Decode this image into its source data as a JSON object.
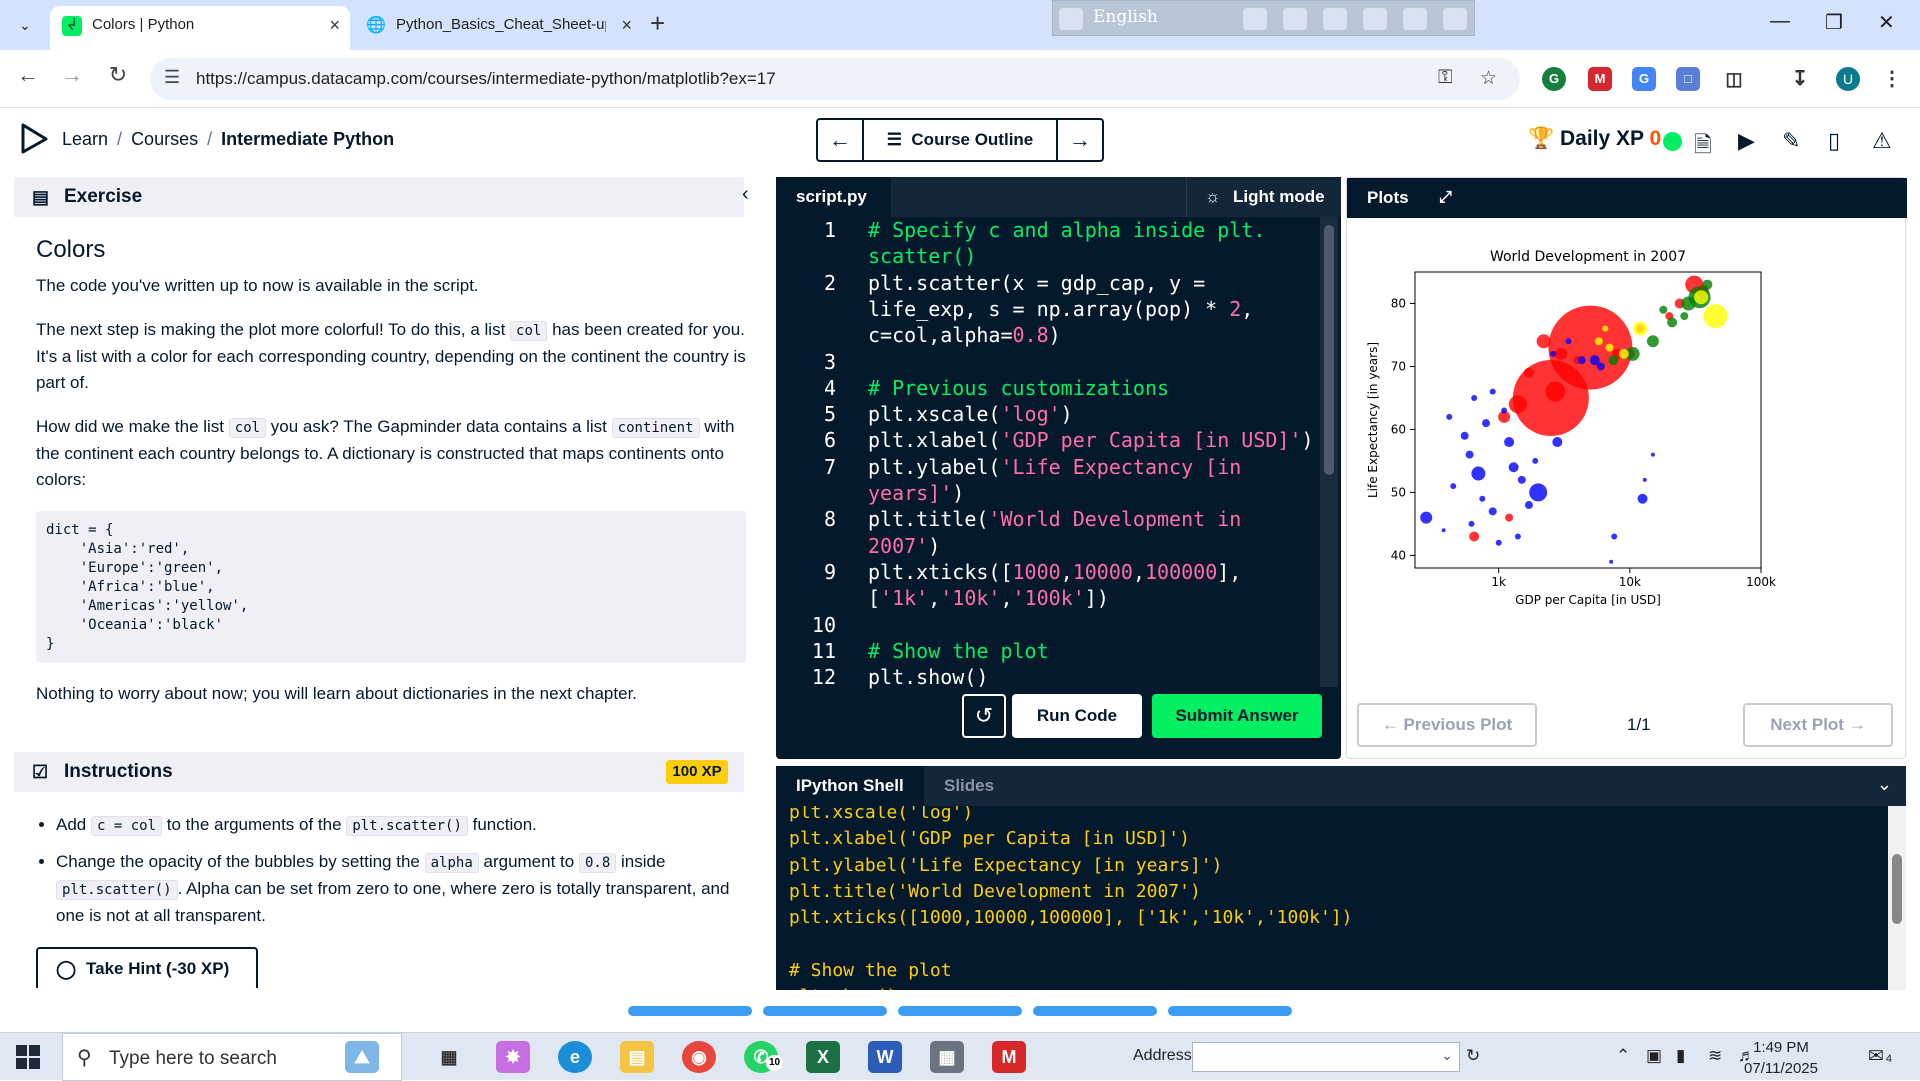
{
  "browser": {
    "tabs": [
      {
        "title": "Colors | Python",
        "active": true,
        "favicon": "datacamp-icon"
      },
      {
        "title": "Python_Basics_Cheat_Sheet-upd",
        "active": false,
        "favicon": "globe-icon"
      }
    ],
    "url": "https://campus.datacamp.com/courses/intermediate-python/matplotlib?ex=17",
    "extension_bar_text": "English",
    "profile_initial": "U"
  },
  "header": {
    "breadcrumbs": [
      "Learn",
      "Courses",
      "Intermediate Python"
    ],
    "course_outline_label": "Course Outline",
    "daily_xp_label": "Daily XP",
    "daily_xp_value": "0"
  },
  "exercise": {
    "section_label": "Exercise",
    "title": "Colors",
    "p1": "The code you've written up to now is available in the script.",
    "p2_a": "The next step is making the plot more colorful! To do this, a list",
    "p2_code": "col",
    "p2_b": "has been created for you. It's a list with a color for each corresponding country, depending on the continent the country is part of.",
    "p3_a": "How did we make the list",
    "p3_code1": "col",
    "p3_b": "you ask? The Gapminder data contains a list",
    "p3_code2": "continent",
    "p3_c": "with the continent each country belongs to. A dictionary is constructed that maps continents onto colors:",
    "code_block": "dict = {\n    'Asia':'red',\n    'Europe':'green',\n    'Africa':'blue',\n    'Americas':'yellow',\n    'Oceania':'black'\n}",
    "p4": "Nothing to worry about now; you will learn about dictionaries in the next chapter."
  },
  "instructions": {
    "section_label": "Instructions",
    "xp_badge": "100 XP",
    "i1_a": "Add",
    "i1_code1": "c = col",
    "i1_b": "to the arguments of the",
    "i1_code2": "plt.scatter()",
    "i1_c": "function.",
    "i2_a": "Change the opacity of the bubbles by setting the",
    "i2_code1": "alpha",
    "i2_b": "argument to",
    "i2_code2": "0.8",
    "i2_c": "inside",
    "i2_code3": "plt.scatter()",
    "i2_d": ". Alpha can be set from zero to one, where zero is totally transparent, and one is not at all transparent.",
    "hint_label": "Take Hint (-30 XP)"
  },
  "editor": {
    "file_tab": "script.py",
    "light_mode_label": "Light mode",
    "line_numbers": [
      "1",
      "2",
      "3",
      "4",
      "5",
      "6",
      "7",
      "8",
      "9",
      "10",
      "11",
      "12"
    ],
    "run_label": "Run Code",
    "submit_label": "Submit Answer"
  },
  "plots": {
    "tab_label": "Plots",
    "previous_label": "Previous Plot",
    "next_label": "Next Plot",
    "counter": "1/1"
  },
  "chart_data": {
    "type": "scatter",
    "title": "World Development in 2007",
    "xlabel": "GDP per Capita [in USD]",
    "ylabel": "Life Expectancy [in years]",
    "xscale": "log",
    "xlim": [
      230,
      100000
    ],
    "ylim": [
      38,
      85
    ],
    "xticks": [
      1000,
      10000,
      100000
    ],
    "xticklabels": [
      "1k",
      "10k",
      "100k"
    ],
    "yticks": [
      40,
      50,
      60,
      70,
      80
    ],
    "yticklabels": [
      "40",
      "50",
      "60",
      "70",
      "80"
    ],
    "colors": {
      "red": "#ff0000",
      "green": "#008000",
      "blue": "#0000ff",
      "yellow": "#ffff00",
      "black": "#000000"
    },
    "points": [
      {
        "x": 5000,
        "y": 73,
        "s": 42,
        "c": "red"
      },
      {
        "x": 2500,
        "y": 65,
        "s": 38,
        "c": "red"
      },
      {
        "x": 2700,
        "y": 66,
        "s": 10,
        "c": "red"
      },
      {
        "x": 1400,
        "y": 64,
        "s": 9,
        "c": "red"
      },
      {
        "x": 1100,
        "y": 62,
        "s": 6,
        "c": "red"
      },
      {
        "x": 1700,
        "y": 69,
        "s": 5,
        "c": "red"
      },
      {
        "x": 2200,
        "y": 74,
        "s": 7,
        "c": "red"
      },
      {
        "x": 3000,
        "y": 72,
        "s": 6,
        "c": "red"
      },
      {
        "x": 10000,
        "y": 72,
        "s": 5,
        "c": "red"
      },
      {
        "x": 24000,
        "y": 80,
        "s": 5,
        "c": "red"
      },
      {
        "x": 31000,
        "y": 83,
        "s": 9,
        "c": "red"
      },
      {
        "x": 36000,
        "y": 82,
        "s": 6,
        "c": "red"
      },
      {
        "x": 12000,
        "y": 76,
        "s": 4,
        "c": "red"
      },
      {
        "x": 8000,
        "y": 72,
        "s": 5,
        "c": "red"
      },
      {
        "x": 1200,
        "y": 46,
        "s": 4,
        "c": "red"
      },
      {
        "x": 650,
        "y": 43,
        "s": 5,
        "c": "red"
      },
      {
        "x": 4000,
        "y": 71,
        "s": 4,
        "c": "red"
      },
      {
        "x": 20000,
        "y": 78,
        "s": 4,
        "c": "red"
      },
      {
        "x": 34000,
        "y": 81,
        "s": 11,
        "c": "green"
      },
      {
        "x": 28000,
        "y": 80,
        "s": 7,
        "c": "green"
      },
      {
        "x": 21000,
        "y": 77,
        "s": 5,
        "c": "green"
      },
      {
        "x": 15000,
        "y": 74,
        "s": 6,
        "c": "green"
      },
      {
        "x": 10500,
        "y": 72,
        "s": 7,
        "c": "green"
      },
      {
        "x": 7500,
        "y": 71,
        "s": 5,
        "c": "green"
      },
      {
        "x": 26000,
        "y": 78,
        "s": 4,
        "c": "green"
      },
      {
        "x": 39000,
        "y": 83,
        "s": 5,
        "c": "green"
      },
      {
        "x": 18000,
        "y": 79,
        "s": 4,
        "c": "green"
      },
      {
        "x": 45000,
        "y": 78,
        "s": 12,
        "c": "yellow"
      },
      {
        "x": 12000,
        "y": 76,
        "s": 7,
        "c": "yellow"
      },
      {
        "x": 9000,
        "y": 72,
        "s": 5,
        "c": "yellow"
      },
      {
        "x": 7000,
        "y": 73,
        "s": 4,
        "c": "yellow"
      },
      {
        "x": 5800,
        "y": 74,
        "s": 4,
        "c": "yellow"
      },
      {
        "x": 35000,
        "y": 81,
        "s": 7,
        "c": "yellow"
      },
      {
        "x": 6500,
        "y": 76,
        "s": 3,
        "c": "yellow"
      },
      {
        "x": 4300,
        "y": 71,
        "s": 4,
        "c": "blue"
      },
      {
        "x": 5400,
        "y": 71,
        "s": 5,
        "c": "blue"
      },
      {
        "x": 6000,
        "y": 70,
        "s": 4,
        "c": "blue"
      },
      {
        "x": 2800,
        "y": 58,
        "s": 5,
        "c": "blue"
      },
      {
        "x": 2000,
        "y": 50,
        "s": 9,
        "c": "blue"
      },
      {
        "x": 280,
        "y": 46,
        "s": 6,
        "c": "blue"
      },
      {
        "x": 700,
        "y": 53,
        "s": 7,
        "c": "blue"
      },
      {
        "x": 1200,
        "y": 58,
        "s": 5,
        "c": "blue"
      },
      {
        "x": 800,
        "y": 61,
        "s": 4,
        "c": "blue"
      },
      {
        "x": 550,
        "y": 59,
        "s": 4,
        "c": "blue"
      },
      {
        "x": 600,
        "y": 56,
        "s": 4,
        "c": "blue"
      },
      {
        "x": 450,
        "y": 51,
        "s": 3,
        "c": "blue"
      },
      {
        "x": 900,
        "y": 47,
        "s": 4,
        "c": "blue"
      },
      {
        "x": 1000,
        "y": 42,
        "s": 3,
        "c": "blue"
      },
      {
        "x": 1300,
        "y": 54,
        "s": 5,
        "c": "blue"
      },
      {
        "x": 1500,
        "y": 52,
        "s": 4,
        "c": "blue"
      },
      {
        "x": 1700,
        "y": 48,
        "s": 4,
        "c": "blue"
      },
      {
        "x": 1900,
        "y": 55,
        "s": 3,
        "c": "blue"
      },
      {
        "x": 750,
        "y": 49,
        "s": 3,
        "c": "blue"
      },
      {
        "x": 620,
        "y": 45,
        "s": 3,
        "c": "blue"
      },
      {
        "x": 1100,
        "y": 63,
        "s": 3,
        "c": "blue"
      },
      {
        "x": 12500,
        "y": 49,
        "s": 5,
        "c": "blue"
      },
      {
        "x": 7600,
        "y": 43,
        "s": 3,
        "c": "blue"
      },
      {
        "x": 13000,
        "y": 52,
        "s": 2,
        "c": "blue"
      },
      {
        "x": 15000,
        "y": 56,
        "s": 2,
        "c": "blue"
      },
      {
        "x": 7200,
        "y": 39,
        "s": 2,
        "c": "blue"
      },
      {
        "x": 420,
        "y": 62,
        "s": 3,
        "c": "blue"
      },
      {
        "x": 650,
        "y": 65,
        "s": 3,
        "c": "blue"
      },
      {
        "x": 900,
        "y": 66,
        "s": 3,
        "c": "blue"
      },
      {
        "x": 1400,
        "y": 43,
        "s": 3,
        "c": "blue"
      },
      {
        "x": 380,
        "y": 44,
        "s": 2,
        "c": "blue"
      },
      {
        "x": 3400,
        "y": 74,
        "s": 3,
        "c": "blue"
      },
      {
        "x": 2600,
        "y": 72,
        "s": 3,
        "c": "blue"
      }
    ]
  },
  "shell": {
    "tab_active": "IPython Shell",
    "tab_inactive": "Slides"
  },
  "taskbar": {
    "search_placeholder": "Type here to search",
    "address_label": "Address",
    "time": "1:49 PM",
    "date": "07/11/2025",
    "whatsapp_badge": "10",
    "notification_count": "4"
  }
}
